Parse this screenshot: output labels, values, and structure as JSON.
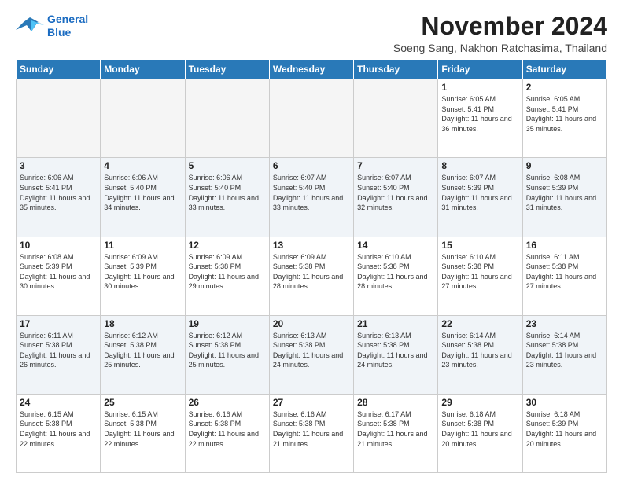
{
  "logo": {
    "line1": "General",
    "line2": "Blue"
  },
  "title": "November 2024",
  "subtitle": "Soeng Sang, Nakhon Ratchasima, Thailand",
  "weekdays": [
    "Sunday",
    "Monday",
    "Tuesday",
    "Wednesday",
    "Thursday",
    "Friday",
    "Saturday"
  ],
  "weeks": [
    [
      {
        "day": "",
        "info": ""
      },
      {
        "day": "",
        "info": ""
      },
      {
        "day": "",
        "info": ""
      },
      {
        "day": "",
        "info": ""
      },
      {
        "day": "",
        "info": ""
      },
      {
        "day": "1",
        "info": "Sunrise: 6:05 AM\nSunset: 5:41 PM\nDaylight: 11 hours and 36 minutes."
      },
      {
        "day": "2",
        "info": "Sunrise: 6:05 AM\nSunset: 5:41 PM\nDaylight: 11 hours and 35 minutes."
      }
    ],
    [
      {
        "day": "3",
        "info": "Sunrise: 6:06 AM\nSunset: 5:41 PM\nDaylight: 11 hours and 35 minutes."
      },
      {
        "day": "4",
        "info": "Sunrise: 6:06 AM\nSunset: 5:40 PM\nDaylight: 11 hours and 34 minutes."
      },
      {
        "day": "5",
        "info": "Sunrise: 6:06 AM\nSunset: 5:40 PM\nDaylight: 11 hours and 33 minutes."
      },
      {
        "day": "6",
        "info": "Sunrise: 6:07 AM\nSunset: 5:40 PM\nDaylight: 11 hours and 33 minutes."
      },
      {
        "day": "7",
        "info": "Sunrise: 6:07 AM\nSunset: 5:40 PM\nDaylight: 11 hours and 32 minutes."
      },
      {
        "day": "8",
        "info": "Sunrise: 6:07 AM\nSunset: 5:39 PM\nDaylight: 11 hours and 31 minutes."
      },
      {
        "day": "9",
        "info": "Sunrise: 6:08 AM\nSunset: 5:39 PM\nDaylight: 11 hours and 31 minutes."
      }
    ],
    [
      {
        "day": "10",
        "info": "Sunrise: 6:08 AM\nSunset: 5:39 PM\nDaylight: 11 hours and 30 minutes."
      },
      {
        "day": "11",
        "info": "Sunrise: 6:09 AM\nSunset: 5:39 PM\nDaylight: 11 hours and 30 minutes."
      },
      {
        "day": "12",
        "info": "Sunrise: 6:09 AM\nSunset: 5:38 PM\nDaylight: 11 hours and 29 minutes."
      },
      {
        "day": "13",
        "info": "Sunrise: 6:09 AM\nSunset: 5:38 PM\nDaylight: 11 hours and 28 minutes."
      },
      {
        "day": "14",
        "info": "Sunrise: 6:10 AM\nSunset: 5:38 PM\nDaylight: 11 hours and 28 minutes."
      },
      {
        "day": "15",
        "info": "Sunrise: 6:10 AM\nSunset: 5:38 PM\nDaylight: 11 hours and 27 minutes."
      },
      {
        "day": "16",
        "info": "Sunrise: 6:11 AM\nSunset: 5:38 PM\nDaylight: 11 hours and 27 minutes."
      }
    ],
    [
      {
        "day": "17",
        "info": "Sunrise: 6:11 AM\nSunset: 5:38 PM\nDaylight: 11 hours and 26 minutes."
      },
      {
        "day": "18",
        "info": "Sunrise: 6:12 AM\nSunset: 5:38 PM\nDaylight: 11 hours and 25 minutes."
      },
      {
        "day": "19",
        "info": "Sunrise: 6:12 AM\nSunset: 5:38 PM\nDaylight: 11 hours and 25 minutes."
      },
      {
        "day": "20",
        "info": "Sunrise: 6:13 AM\nSunset: 5:38 PM\nDaylight: 11 hours and 24 minutes."
      },
      {
        "day": "21",
        "info": "Sunrise: 6:13 AM\nSunset: 5:38 PM\nDaylight: 11 hours and 24 minutes."
      },
      {
        "day": "22",
        "info": "Sunrise: 6:14 AM\nSunset: 5:38 PM\nDaylight: 11 hours and 23 minutes."
      },
      {
        "day": "23",
        "info": "Sunrise: 6:14 AM\nSunset: 5:38 PM\nDaylight: 11 hours and 23 minutes."
      }
    ],
    [
      {
        "day": "24",
        "info": "Sunrise: 6:15 AM\nSunset: 5:38 PM\nDaylight: 11 hours and 22 minutes."
      },
      {
        "day": "25",
        "info": "Sunrise: 6:15 AM\nSunset: 5:38 PM\nDaylight: 11 hours and 22 minutes."
      },
      {
        "day": "26",
        "info": "Sunrise: 6:16 AM\nSunset: 5:38 PM\nDaylight: 11 hours and 22 minutes."
      },
      {
        "day": "27",
        "info": "Sunrise: 6:16 AM\nSunset: 5:38 PM\nDaylight: 11 hours and 21 minutes."
      },
      {
        "day": "28",
        "info": "Sunrise: 6:17 AM\nSunset: 5:38 PM\nDaylight: 11 hours and 21 minutes."
      },
      {
        "day": "29",
        "info": "Sunrise: 6:18 AM\nSunset: 5:38 PM\nDaylight: 11 hours and 20 minutes."
      },
      {
        "day": "30",
        "info": "Sunrise: 6:18 AM\nSunset: 5:39 PM\nDaylight: 11 hours and 20 minutes."
      }
    ]
  ]
}
